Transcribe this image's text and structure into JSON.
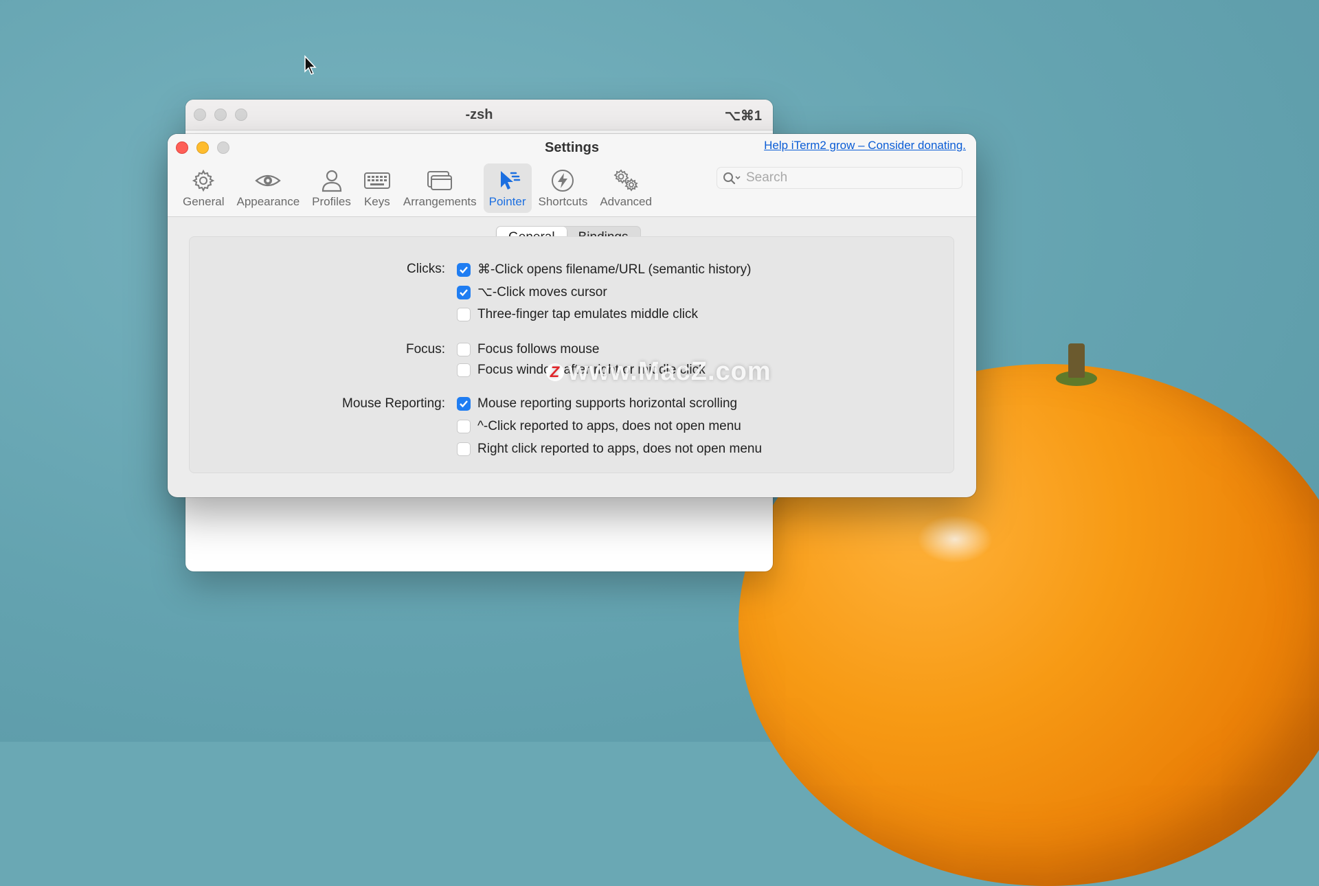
{
  "terminal": {
    "title": "-zsh",
    "shortcut": "⌥⌘1"
  },
  "settings": {
    "title": "Settings",
    "donate_link": "Help iTerm2 grow – Consider donating.",
    "toolbar": [
      {
        "label": "General",
        "icon": "gear-icon"
      },
      {
        "label": "Appearance",
        "icon": "eye-icon"
      },
      {
        "label": "Profiles",
        "icon": "person-icon"
      },
      {
        "label": "Keys",
        "icon": "keyboard-icon"
      },
      {
        "label": "Arrangements",
        "icon": "windows-icon"
      },
      {
        "label": "Pointer",
        "icon": "pointer-icon",
        "active": true
      },
      {
        "label": "Shortcuts",
        "icon": "bolt-icon"
      },
      {
        "label": "Advanced",
        "icon": "gears-icon"
      }
    ],
    "search": {
      "placeholder": "Search",
      "value": ""
    },
    "tabs": [
      {
        "label": "General",
        "selected": true
      },
      {
        "label": "Bindings",
        "selected": false
      }
    ],
    "sections": {
      "clicks": {
        "label": "Clicks:",
        "options": [
          {
            "label": "⌘-Click opens filename/URL (semantic history)",
            "checked": true
          },
          {
            "label": "⌥-Click moves cursor",
            "checked": true
          },
          {
            "label": "Three-finger tap emulates middle click",
            "checked": false
          }
        ]
      },
      "focus": {
        "label": "Focus:",
        "options": [
          {
            "label": "Focus follows mouse",
            "checked": false
          },
          {
            "label": "Focus window after right or middle click",
            "checked": false
          }
        ]
      },
      "mouse_reporting": {
        "label": "Mouse Reporting:",
        "options": [
          {
            "label": "Mouse reporting supports horizontal scrolling",
            "checked": true
          },
          {
            "label": "^-Click reported to apps, does not open menu",
            "checked": false
          },
          {
            "label": "Right click reported to apps, does not open menu",
            "checked": false
          }
        ]
      }
    }
  },
  "watermark": {
    "letter": "Z",
    "text": "www.MacZ.com"
  },
  "colors": {
    "accent": "#1f7df2",
    "link": "#0a5cd5",
    "desktop": "#6aa8b4",
    "orange": "#f79a14"
  }
}
